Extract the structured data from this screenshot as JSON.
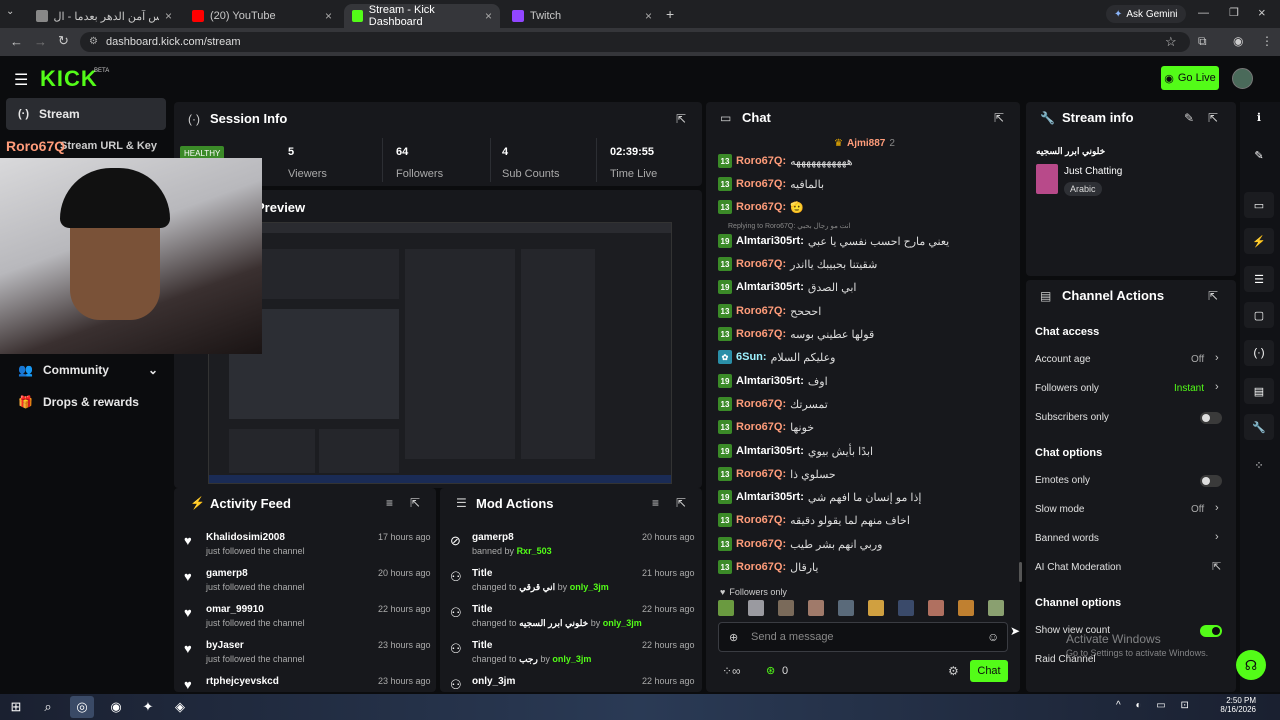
{
  "browser": {
    "tabs": [
      {
        "label": "على أي عرس آمن الدهر بعدما - ال"
      },
      {
        "label": "(20) YouTube"
      },
      {
        "label": "Stream - Kick Dashboard"
      },
      {
        "label": "Twitch"
      }
    ],
    "ask_gemini": "Ask Gemini",
    "url": "dashboard.kick.com/stream"
  },
  "header": {
    "logo": "KICK",
    "logo_beta": "BETA",
    "go_live": "Go Live"
  },
  "sidebar": {
    "items": [
      {
        "label": "Stream"
      },
      {
        "label": "Community"
      },
      {
        "label": "Drops & rewards"
      }
    ],
    "partial_label": "Stream URL & Key"
  },
  "webcam": {
    "overlay_name": "Roro67Q"
  },
  "session": {
    "title": "Session Info",
    "health": "HEALTHY",
    "stats": [
      {
        "value": "5",
        "label": "Viewers"
      },
      {
        "value": "64",
        "label": "Followers"
      },
      {
        "value": "4",
        "label": "Sub Counts"
      },
      {
        "value": "02:39:55",
        "label": "Time Live"
      }
    ]
  },
  "preview": {
    "title": "Preview"
  },
  "activity": {
    "title": "Activity Feed",
    "rows": [
      {
        "name": "Khalidosimi2008",
        "sub": "just followed the channel",
        "time": "17 hours ago"
      },
      {
        "name": "gamerp8",
        "sub": "just followed the channel",
        "time": "20 hours ago"
      },
      {
        "name": "omar_99910",
        "sub": "just followed the channel",
        "time": "22 hours ago"
      },
      {
        "name": "byJaser",
        "sub": "just followed the channel",
        "time": "23 hours ago"
      },
      {
        "name": "rtphejcyevskcd",
        "sub": "",
        "time": "23 hours ago"
      }
    ]
  },
  "mod": {
    "title": "Mod Actions",
    "rows": [
      {
        "name": "gamerp8",
        "pre": "banned by",
        "val": "",
        "by": "Rxr_503",
        "time": "20 hours ago"
      },
      {
        "name": "Title",
        "pre": "changed to",
        "val": "اني قرقي",
        "by": "only_3jm",
        "time": "21 hours ago"
      },
      {
        "name": "Title",
        "pre": "changed to",
        "val": "خلوني ابرر السجيه",
        "by": "only_3jm",
        "time": "22 hours ago"
      },
      {
        "name": "Title",
        "pre": "changed to",
        "val": "رجب",
        "by": "only_3jm",
        "time": "22 hours ago"
      },
      {
        "name": "only_3jm",
        "pre": "",
        "val": "",
        "by": "",
        "time": "22 hours ago"
      }
    ]
  },
  "chat": {
    "title": "Chat",
    "pinned_user": "Ajmi887",
    "pinned_count": "2",
    "reply_note": "Replying to Roro67Q: انت مو رجال بحبي",
    "messages": [
      {
        "badge": "13",
        "user": "Roro67Q:",
        "text": "هههههههههههه",
        "color": "orange"
      },
      {
        "badge": "13",
        "user": "Roro67Q:",
        "text": "بالمافيه",
        "color": "orange"
      },
      {
        "badge": "13",
        "user": "Roro67Q:",
        "text": "🫡",
        "color": "orange"
      },
      {
        "badge": "19",
        "user": "Almtari305rt:",
        "text": "يعني مارح احسب نفسي يا عبي",
        "color": "white"
      },
      {
        "badge": "13",
        "user": "Roro67Q:",
        "text": "شقيتنا بحبيبك يااندر",
        "color": "orange"
      },
      {
        "badge": "19",
        "user": "Almtari305rt:",
        "text": "ابي الصدق",
        "color": "white"
      },
      {
        "badge": "13",
        "user": "Roro67Q:",
        "text": "احححح",
        "color": "orange"
      },
      {
        "badge": "13",
        "user": "Roro67Q:",
        "text": "قولها عطيني بوسه",
        "color": "orange"
      },
      {
        "badge": "",
        "user": "6Sun:",
        "text": "وعليكم السلام",
        "color": "cyan"
      },
      {
        "badge": "19",
        "user": "Almtari305rt:",
        "text": "اوف",
        "color": "white"
      },
      {
        "badge": "13",
        "user": "Roro67Q:",
        "text": "تمسرتك",
        "color": "orange"
      },
      {
        "badge": "13",
        "user": "Roro67Q:",
        "text": "خونها",
        "color": "orange"
      },
      {
        "badge": "19",
        "user": "Almtari305rt:",
        "text": "ابدًا بأيش بيوي",
        "color": "white"
      },
      {
        "badge": "13",
        "user": "Roro67Q:",
        "text": "حسلوي ذا",
        "color": "orange"
      },
      {
        "badge": "19",
        "user": "Almtari305rt:",
        "text": "إذا مو إنسان ما افهم شي",
        "color": "white"
      },
      {
        "badge": "13",
        "user": "Roro67Q:",
        "text": "اخاف منهم لما يقولو دقيقه",
        "color": "orange"
      },
      {
        "badge": "13",
        "user": "Roro67Q:",
        "text": "وربي انهم بشر طيب",
        "color": "orange"
      },
      {
        "badge": "13",
        "user": "Roro67Q:",
        "text": "يارقال",
        "color": "orange"
      }
    ],
    "followers_only": "Followers only",
    "input_placeholder": "Send a message",
    "points": "0",
    "send": "Chat"
  },
  "stream_info": {
    "title": "Stream info",
    "stream_title": "خلوني ابرر السجيه",
    "category": "Just Chatting",
    "tag": "Arabic"
  },
  "channel_actions": {
    "title": "Channel Actions",
    "chat_access": "Chat access",
    "account_age": {
      "label": "Account age",
      "value": "Off"
    },
    "followers_only": {
      "label": "Followers only",
      "value": "Instant"
    },
    "subscribers_only": {
      "label": "Subscribers only"
    },
    "chat_options": "Chat options",
    "emotes_only": {
      "label": "Emotes only"
    },
    "slow_mode": {
      "label": "Slow mode",
      "value": "Off"
    },
    "banned_words": {
      "label": "Banned words"
    },
    "ai_moderation": {
      "label": "AI Chat Moderation"
    },
    "channel_options": "Channel options",
    "show_view_count": {
      "label": "Show view count"
    },
    "raid_channel": {
      "label": "Raid Channel"
    }
  },
  "watermark": {
    "line1": "Activate Windows",
    "line2": "Go to Settings to activate Windows."
  },
  "taskbar": {
    "time": "2:50 PM",
    "date": "8/16/2026"
  },
  "colors": {
    "kick_green": "#53fc18",
    "badge_green": "#3b8a28",
    "panel": "#17181c"
  }
}
